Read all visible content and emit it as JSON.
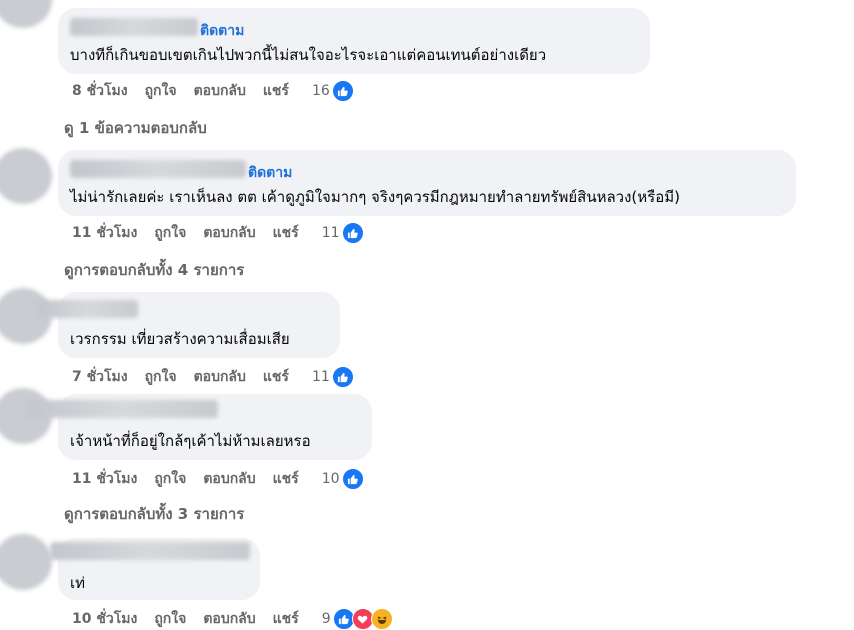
{
  "comments": [
    {
      "follow_label": "ติดตาม",
      "text": "บางทีก็เกินขอบเขตเกินไปพวกนี้ไม่สนใจอะไรจะเอาแต่คอนเทนต์อย่างเดียว",
      "time": "8 ชั่วโมง",
      "like": "ถูกใจ",
      "reply": "ตอบกลับ",
      "share": "แชร์",
      "reaction_count": "16",
      "reactions": [
        "like-icon"
      ]
    },
    {
      "follow_label": "ติดตาม",
      "text": "ไม่น่ารักเลยค่ะ เราเห็นลง ตต เค้าดูภูมิใจมากๆ จริงๆควรมีกฎหมายทำลายทรัพย์สินหลวง(หรือมี)",
      "time": "11 ชั่วโมง",
      "like": "ถูกใจ",
      "reply": "ตอบกลับ",
      "share": "แชร์",
      "reaction_count": "11",
      "reactions": [
        "like-icon"
      ]
    },
    {
      "text": "เวรกรรม เที่ยวสร้างความเสื่อมเสีย",
      "time": "7 ชั่วโมง",
      "like": "ถูกใจ",
      "reply": "ตอบกลับ",
      "share": "แชร์",
      "reaction_count": "11",
      "reactions": [
        "like-icon"
      ]
    },
    {
      "text": "เจ้าหน้าที่ก็อยู่ใกล้ๆเค้าไม่ห้ามเลยหรอ",
      "time": "11 ชั่วโมง",
      "like": "ถูกใจ",
      "reply": "ตอบกลับ",
      "share": "แชร์",
      "reaction_count": "10",
      "reactions": [
        "like-icon"
      ]
    },
    {
      "text": "เท่",
      "time": "10 ชั่วโมง",
      "like": "ถูกใจ",
      "reply": "ตอบกลับ",
      "share": "แชร์",
      "reaction_count": "9",
      "reactions": [
        "like-icon",
        "love-icon",
        "haha-icon"
      ]
    }
  ],
  "view_replies": [
    "ดู 1 ข้อความตอบกลับ",
    "ดูการตอบกลับทั้ง 4 รายการ",
    "ดูการตอบกลับทั้ง 3 รายการ"
  ],
  "colors": {
    "bubble": "#f0f2f5",
    "meta": "#65676b",
    "follow": "#216fdb",
    "like": "#1877f2",
    "love": "#f33e58",
    "haha": "#f7b125"
  }
}
